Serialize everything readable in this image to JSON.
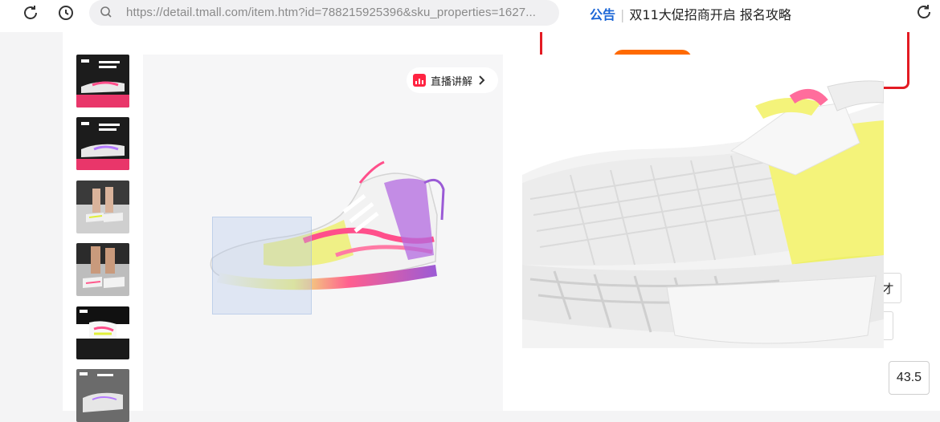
{
  "browser": {
    "url": "https://detail.tmall.com/item.htm?id=788215925396&sku_properties=1627...",
    "icons": [
      "reload-icon",
      "history-icon",
      "search-icon",
      "refresh-icon"
    ]
  },
  "announcement": {
    "tag": "公告",
    "message": "双11大促招商开启 报名攻略"
  },
  "gallery": {
    "thumbnails": [
      "shoe-promo-thumb-1",
      "shoe-promo-thumb-2",
      "on-foot-thumb-1",
      "on-foot-thumb-2",
      "shoe-detail-thumb",
      "shoe-box-thumb"
    ],
    "live_label": "直播讲解"
  },
  "side": {
    "partial_text_1": "才",
    "size_value": "43.5"
  },
  "colors": {
    "accent_red": "#e31b23",
    "accent_orange": "#ff6a00",
    "link_blue": "#1b66d6",
    "live_red": "#ff2442"
  }
}
